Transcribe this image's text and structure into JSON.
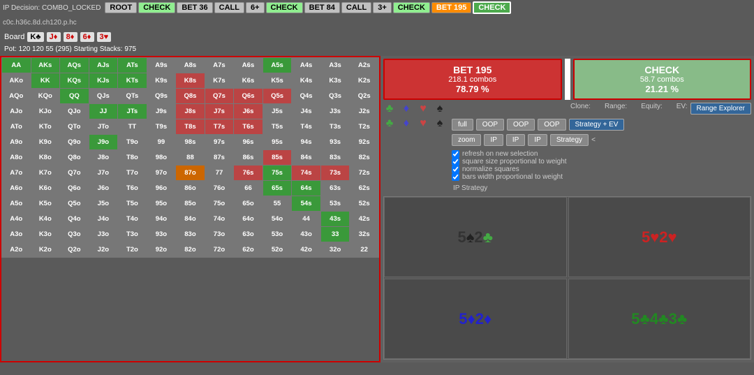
{
  "topbar": {
    "decision": "IP Decision: COMBO_LOCKED",
    "path": "c0c.h36c.8d.ch120.p.hc",
    "buttons": [
      {
        "label": "ROOT",
        "style": "gray"
      },
      {
        "label": "CHECK",
        "style": "green"
      },
      {
        "label": "BET 36",
        "style": "gray"
      },
      {
        "label": "CALL",
        "style": "gray"
      },
      {
        "label": "6+",
        "style": "gray"
      },
      {
        "label": "CHECK",
        "style": "green"
      },
      {
        "label": "BET 84",
        "style": "gray"
      },
      {
        "label": "CALL",
        "style": "gray"
      },
      {
        "label": "3+",
        "style": "gray"
      },
      {
        "label": "CHECK",
        "style": "green"
      },
      {
        "label": "BET 195",
        "style": "orange"
      },
      {
        "label": "CHECK",
        "style": "active-green"
      }
    ]
  },
  "board": {
    "label": "Board",
    "cards": [
      {
        "value": "K♣",
        "color": "black"
      },
      {
        "value": "J♦",
        "color": "red"
      },
      {
        "value": "8♦",
        "color": "red"
      },
      {
        "value": "6♦",
        "color": "red"
      },
      {
        "value": "3♥",
        "color": "red"
      }
    ]
  },
  "pot": "Pot: 120 120 55 (295)  Starting Stacks: 975",
  "actions": {
    "bet": {
      "name": "BET 195",
      "combos": "218.1 combos",
      "pct": "78.79 %"
    },
    "check": {
      "name": "CHECK",
      "combos": "58.7 combos",
      "pct": "21.21 %"
    }
  },
  "controls": {
    "clone_label": "Clone:",
    "range_label": "Range:",
    "equity_label": "Equity:",
    "ev_label": "EV:",
    "range_explorer": "Range Explorer",
    "full_btn": "full",
    "zoom_btn": "zoom",
    "oop_btn1": "OOP",
    "oop_btn2": "OOP",
    "oop_btn3": "OOP",
    "ip_btn1": "IP",
    "ip_btn2": "IP",
    "ip_btn3": "IP",
    "strategy_ev": "Strategy + EV",
    "strategy": "Strategy",
    "ip_strategy": "IP Strategy",
    "checkboxes": [
      "refresh on new selection",
      "square size proportional to weight",
      "normalize squares",
      "bars width proportional to weight"
    ]
  },
  "boards": [
    {
      "cards": "5♠2♣",
      "type": "spades-clubs"
    },
    {
      "cards": "5♥2♥",
      "type": "hearts"
    },
    {
      "cards": "5♦2♦",
      "type": "diamonds"
    },
    {
      "cards": "5♣4♣3♣",
      "type": "clubs"
    }
  ],
  "matrix": {
    "headers": [
      "AA",
      "AKs",
      "AQs",
      "AJs",
      "ATs",
      "A9s",
      "A8s",
      "A7s",
      "A6s",
      "A5s",
      "A4s",
      "A3s",
      "A2s"
    ],
    "rows": [
      {
        "label": "AA",
        "cells": [
          {
            "v": "AA",
            "c": "green"
          },
          {
            "v": "AKs",
            "c": "green"
          },
          {
            "v": "AQs",
            "c": "green"
          },
          {
            "v": "AJs",
            "c": "green"
          },
          {
            "v": "ATs",
            "c": "green"
          },
          {
            "v": "A9s",
            "c": "default"
          },
          {
            "v": "A8s",
            "c": "default"
          },
          {
            "v": "A7s",
            "c": "default"
          },
          {
            "v": "A6s",
            "c": "default"
          },
          {
            "v": "A5s",
            "c": "green"
          },
          {
            "v": "A4s",
            "c": "default"
          },
          {
            "v": "A3s",
            "c": "default"
          },
          {
            "v": "A2s",
            "c": "default"
          }
        ]
      },
      {
        "label": "AKo",
        "cells": [
          {
            "v": "AKo",
            "c": "default"
          },
          {
            "v": "KK",
            "c": "green"
          },
          {
            "v": "KQs",
            "c": "green"
          },
          {
            "v": "KJs",
            "c": "green"
          },
          {
            "v": "KTs",
            "c": "green"
          },
          {
            "v": "K9s",
            "c": "default"
          },
          {
            "v": "K8s",
            "c": "red"
          },
          {
            "v": "K7s",
            "c": "default"
          },
          {
            "v": "K6s",
            "c": "default"
          },
          {
            "v": "K5s",
            "c": "default"
          },
          {
            "v": "K4s",
            "c": "default"
          },
          {
            "v": "K3s",
            "c": "default"
          },
          {
            "v": "K2s",
            "c": "default"
          }
        ]
      },
      {
        "label": "AQo",
        "cells": [
          {
            "v": "AQo",
            "c": "default"
          },
          {
            "v": "KQo",
            "c": "default"
          },
          {
            "v": "QQ",
            "c": "green"
          },
          {
            "v": "QJs",
            "c": "default"
          },
          {
            "v": "QTs",
            "c": "default"
          },
          {
            "v": "Q9s",
            "c": "default"
          },
          {
            "v": "Q8s",
            "c": "red"
          },
          {
            "v": "Q7s",
            "c": "red"
          },
          {
            "v": "Q6s",
            "c": "red"
          },
          {
            "v": "Q5s",
            "c": "red"
          },
          {
            "v": "Q4s",
            "c": "default"
          },
          {
            "v": "Q3s",
            "c": "default"
          },
          {
            "v": "Q2s",
            "c": "default"
          }
        ]
      },
      {
        "label": "AJo",
        "cells": [
          {
            "v": "AJo",
            "c": "default"
          },
          {
            "v": "KJo",
            "c": "default"
          },
          {
            "v": "QJo",
            "c": "default"
          },
          {
            "v": "JJ",
            "c": "green"
          },
          {
            "v": "JTs",
            "c": "green"
          },
          {
            "v": "J9s",
            "c": "default"
          },
          {
            "v": "J8s",
            "c": "red"
          },
          {
            "v": "J7s",
            "c": "red"
          },
          {
            "v": "J6s",
            "c": "red"
          },
          {
            "v": "J5s",
            "c": "default"
          },
          {
            "v": "J4s",
            "c": "default"
          },
          {
            "v": "J3s",
            "c": "default"
          },
          {
            "v": "J2s",
            "c": "default"
          }
        ]
      },
      {
        "label": "ATo",
        "cells": [
          {
            "v": "ATo",
            "c": "default"
          },
          {
            "v": "KTo",
            "c": "default"
          },
          {
            "v": "QTo",
            "c": "default"
          },
          {
            "v": "JTo",
            "c": "default"
          },
          {
            "v": "TT",
            "c": "default"
          },
          {
            "v": "T9s",
            "c": "default"
          },
          {
            "v": "T8s",
            "c": "red"
          },
          {
            "v": "T7s",
            "c": "red"
          },
          {
            "v": "T6s",
            "c": "red"
          },
          {
            "v": "T5s",
            "c": "default"
          },
          {
            "v": "T4s",
            "c": "default"
          },
          {
            "v": "T3s",
            "c": "default"
          },
          {
            "v": "T2s",
            "c": "default"
          }
        ]
      },
      {
        "label": "A9o",
        "cells": [
          {
            "v": "A9o",
            "c": "default"
          },
          {
            "v": "K9o",
            "c": "default"
          },
          {
            "v": "Q9o",
            "c": "default"
          },
          {
            "v": "J9o",
            "c": "green"
          },
          {
            "v": "T9o",
            "c": "default"
          },
          {
            "v": "99",
            "c": "default"
          },
          {
            "v": "98s",
            "c": "default"
          },
          {
            "v": "97s",
            "c": "default"
          },
          {
            "v": "96s",
            "c": "default"
          },
          {
            "v": "95s",
            "c": "default"
          },
          {
            "v": "94s",
            "c": "default"
          },
          {
            "v": "93s",
            "c": "default"
          },
          {
            "v": "92s",
            "c": "default"
          }
        ]
      },
      {
        "label": "A8o",
        "cells": [
          {
            "v": "A8o",
            "c": "default"
          },
          {
            "v": "K8o",
            "c": "default"
          },
          {
            "v": "Q8o",
            "c": "default"
          },
          {
            "v": "J8o",
            "c": "default"
          },
          {
            "v": "T8o",
            "c": "default"
          },
          {
            "v": "98o",
            "c": "default"
          },
          {
            "v": "88",
            "c": "default"
          },
          {
            "v": "87s",
            "c": "default"
          },
          {
            "v": "86s",
            "c": "default"
          },
          {
            "v": "85s",
            "c": "red"
          },
          {
            "v": "84s",
            "c": "default"
          },
          {
            "v": "83s",
            "c": "default"
          },
          {
            "v": "82s",
            "c": "default"
          }
        ]
      },
      {
        "label": "A7o",
        "cells": [
          {
            "v": "A7o",
            "c": "default"
          },
          {
            "v": "K7o",
            "c": "default"
          },
          {
            "v": "Q7o",
            "c": "default"
          },
          {
            "v": "J7o",
            "c": "default"
          },
          {
            "v": "T7o",
            "c": "default"
          },
          {
            "v": "97o",
            "c": "default"
          },
          {
            "v": "87o",
            "c": "orange"
          },
          {
            "v": "77",
            "c": "default"
          },
          {
            "v": "76s",
            "c": "red"
          },
          {
            "v": "75s",
            "c": "green"
          },
          {
            "v": "74s",
            "c": "red"
          },
          {
            "v": "73s",
            "c": "red"
          },
          {
            "v": "72s",
            "c": "default"
          }
        ]
      },
      {
        "label": "A6o",
        "cells": [
          {
            "v": "A6o",
            "c": "default"
          },
          {
            "v": "K6o",
            "c": "default"
          },
          {
            "v": "Q6o",
            "c": "default"
          },
          {
            "v": "J6o",
            "c": "default"
          },
          {
            "v": "T6o",
            "c": "default"
          },
          {
            "v": "96o",
            "c": "default"
          },
          {
            "v": "86o",
            "c": "default"
          },
          {
            "v": "76o",
            "c": "default"
          },
          {
            "v": "66",
            "c": "default"
          },
          {
            "v": "65s",
            "c": "green"
          },
          {
            "v": "64s",
            "c": "green"
          },
          {
            "v": "63s",
            "c": "default"
          },
          {
            "v": "62s",
            "c": "default"
          }
        ]
      },
      {
        "label": "A5o",
        "cells": [
          {
            "v": "A5o",
            "c": "default"
          },
          {
            "v": "K5o",
            "c": "default"
          },
          {
            "v": "Q5o",
            "c": "default"
          },
          {
            "v": "J5o",
            "c": "default"
          },
          {
            "v": "T5o",
            "c": "default"
          },
          {
            "v": "95o",
            "c": "default"
          },
          {
            "v": "85o",
            "c": "default"
          },
          {
            "v": "75o",
            "c": "default"
          },
          {
            "v": "65o",
            "c": "default"
          },
          {
            "v": "55",
            "c": "default"
          },
          {
            "v": "54s",
            "c": "green"
          },
          {
            "v": "53s",
            "c": "default"
          },
          {
            "v": "52s",
            "c": "default"
          }
        ]
      },
      {
        "label": "A4o",
        "cells": [
          {
            "v": "A4o",
            "c": "default"
          },
          {
            "v": "K4o",
            "c": "default"
          },
          {
            "v": "Q4o",
            "c": "default"
          },
          {
            "v": "J4o",
            "c": "default"
          },
          {
            "v": "T4o",
            "c": "default"
          },
          {
            "v": "94o",
            "c": "default"
          },
          {
            "v": "84o",
            "c": "default"
          },
          {
            "v": "74o",
            "c": "default"
          },
          {
            "v": "64o",
            "c": "default"
          },
          {
            "v": "54o",
            "c": "default"
          },
          {
            "v": "44",
            "c": "default"
          },
          {
            "v": "43s",
            "c": "green"
          },
          {
            "v": "42s",
            "c": "default"
          }
        ]
      },
      {
        "label": "A3o",
        "cells": [
          {
            "v": "A3o",
            "c": "default"
          },
          {
            "v": "K3o",
            "c": "default"
          },
          {
            "v": "Q3o",
            "c": "default"
          },
          {
            "v": "J3o",
            "c": "default"
          },
          {
            "v": "T3o",
            "c": "default"
          },
          {
            "v": "93o",
            "c": "default"
          },
          {
            "v": "83o",
            "c": "default"
          },
          {
            "v": "73o",
            "c": "default"
          },
          {
            "v": "63o",
            "c": "default"
          },
          {
            "v": "53o",
            "c": "default"
          },
          {
            "v": "43o",
            "c": "default"
          },
          {
            "v": "33",
            "c": "green"
          },
          {
            "v": "32s",
            "c": "default"
          }
        ]
      },
      {
        "label": "A2o",
        "cells": [
          {
            "v": "A2o",
            "c": "default"
          },
          {
            "v": "K2o",
            "c": "default"
          },
          {
            "v": "Q2o",
            "c": "default"
          },
          {
            "v": "J2o",
            "c": "default"
          },
          {
            "v": "T2o",
            "c": "default"
          },
          {
            "v": "92o",
            "c": "default"
          },
          {
            "v": "82o",
            "c": "default"
          },
          {
            "v": "72o",
            "c": "default"
          },
          {
            "v": "62o",
            "c": "default"
          },
          {
            "v": "52o",
            "c": "default"
          },
          {
            "v": "42o",
            "c": "default"
          },
          {
            "v": "32o",
            "c": "default"
          },
          {
            "v": "22",
            "c": "default"
          }
        ]
      }
    ]
  }
}
